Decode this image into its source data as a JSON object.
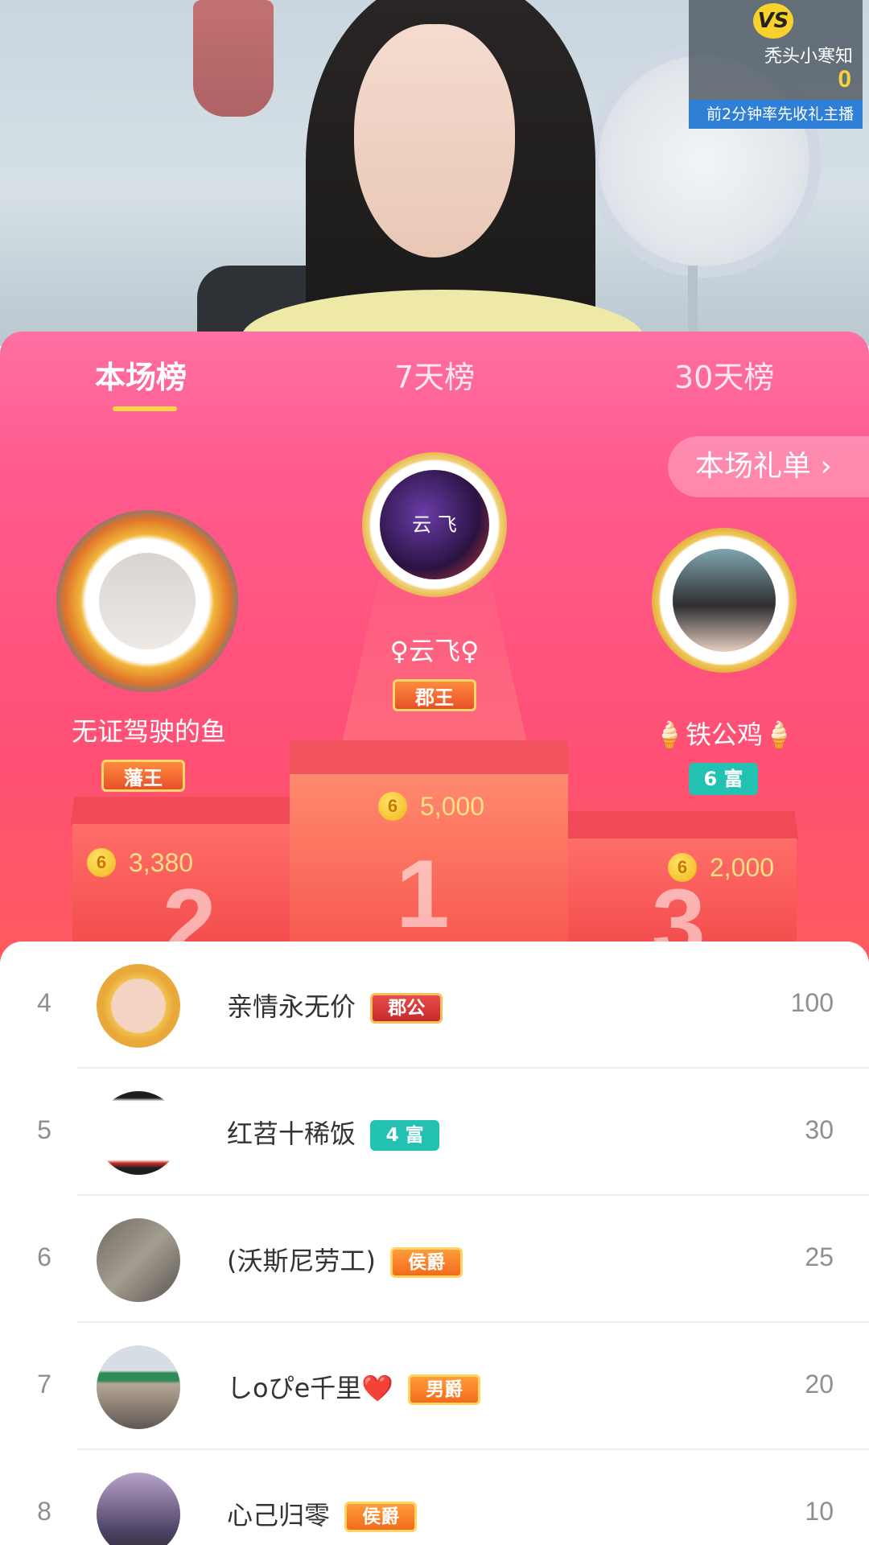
{
  "vs": {
    "badge": "VS",
    "opponent_name": "秃头小寒知",
    "score": "0",
    "tip": "前2分钟率先收礼主播"
  },
  "tabs": [
    {
      "label": "本场榜",
      "active": true
    },
    {
      "label": "7天榜",
      "active": false
    },
    {
      "label": "30天榜",
      "active": false
    }
  ],
  "gift_list_button": "本场礼单 ›",
  "podium": {
    "first": {
      "rank": "1",
      "avatar_text": "云 飞",
      "name": "♀云飞♀",
      "badge": "郡王",
      "coins": "5,000"
    },
    "second": {
      "rank": "2",
      "name": "无证驾驶的鱼",
      "badge": "藩王",
      "coins": "3,380"
    },
    "third": {
      "rank": "3",
      "name": "🍦铁公鸡🍦",
      "badge": "6 富",
      "coins": "2,000"
    }
  },
  "coin_symbol": "6",
  "list": [
    {
      "rank": "4",
      "name": "亲情永无价",
      "badge": "郡公",
      "score": "100"
    },
    {
      "rank": "5",
      "name": "红苕十稀饭",
      "badge": "4 富",
      "score": "30"
    },
    {
      "rank": "6",
      "name": "(沃斯尼劳工)",
      "badge": "侯爵",
      "score": "25"
    },
    {
      "rank": "7",
      "name": "しoぴe千里❤️",
      "badge": "男爵",
      "score": "20"
    },
    {
      "rank": "8",
      "name": "心己归零",
      "badge": "侯爵",
      "score": "10"
    }
  ]
}
